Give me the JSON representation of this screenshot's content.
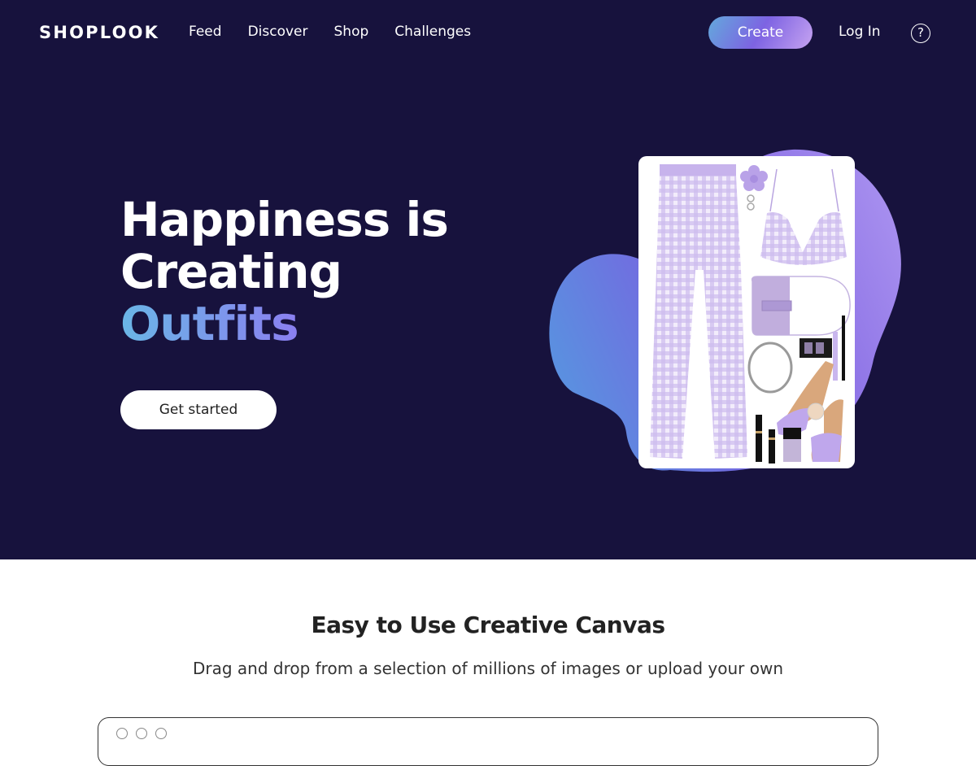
{
  "nav": {
    "logo": "SHOPLOOK",
    "links": [
      "Feed",
      "Discover",
      "Shop",
      "Challenges"
    ],
    "create_label": "Create",
    "login_label": "Log In",
    "help_icon": "question-circle-icon",
    "help_glyph": "?"
  },
  "hero": {
    "headline_line1": "Happiness is",
    "headline_line2": "Creating",
    "headline_accent": "Outfits",
    "cta_label": "Get started",
    "image_description": "Lavender gingham outfit collage: flared pants, halter crop top, purse, jewelry, makeup and mule heels"
  },
  "section": {
    "title": "Easy to Use Creative Canvas",
    "subtitle": "Drag and drop from a selection of millions of images or upload your own"
  },
  "colors": {
    "hero_bg": "#17123d",
    "accent_gradient_start": "#63a9dc",
    "accent_gradient_end": "#9b6ff2",
    "outfit_lavender": "#c9b6ea"
  }
}
